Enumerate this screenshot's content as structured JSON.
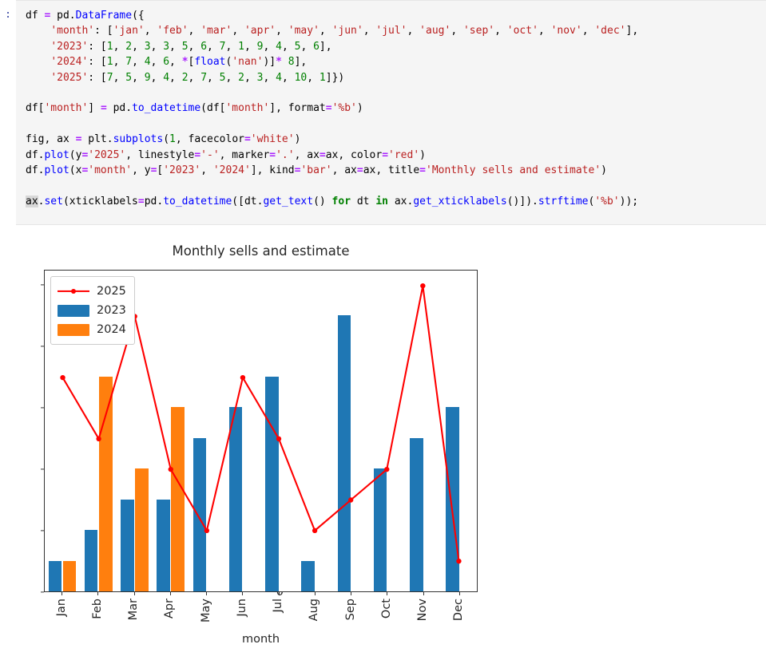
{
  "cell": {
    "prompt": ":",
    "code_lines": [
      [
        {
          "t": "df ",
          "c": "plain"
        },
        {
          "t": "=",
          "c": "op"
        },
        {
          "t": " pd.",
          "c": "plain"
        },
        {
          "t": "DataFrame",
          "c": "fn"
        },
        {
          "t": "({",
          "c": "plain"
        }
      ],
      [
        {
          "t": "    ",
          "c": "plain"
        },
        {
          "t": "'month'",
          "c": "str"
        },
        {
          "t": ": [",
          "c": "plain"
        },
        {
          "t": "'jan'",
          "c": "str"
        },
        {
          "t": ", ",
          "c": "plain"
        },
        {
          "t": "'feb'",
          "c": "str"
        },
        {
          "t": ", ",
          "c": "plain"
        },
        {
          "t": "'mar'",
          "c": "str"
        },
        {
          "t": ", ",
          "c": "plain"
        },
        {
          "t": "'apr'",
          "c": "str"
        },
        {
          "t": ", ",
          "c": "plain"
        },
        {
          "t": "'may'",
          "c": "str"
        },
        {
          "t": ", ",
          "c": "plain"
        },
        {
          "t": "'jun'",
          "c": "str"
        },
        {
          "t": ", ",
          "c": "plain"
        },
        {
          "t": "'jul'",
          "c": "str"
        },
        {
          "t": ", ",
          "c": "plain"
        },
        {
          "t": "'aug'",
          "c": "str"
        },
        {
          "t": ", ",
          "c": "plain"
        },
        {
          "t": "'sep'",
          "c": "str"
        },
        {
          "t": ", ",
          "c": "plain"
        },
        {
          "t": "'oct'",
          "c": "str"
        },
        {
          "t": ", ",
          "c": "plain"
        },
        {
          "t": "'nov'",
          "c": "str"
        },
        {
          "t": ", ",
          "c": "plain"
        },
        {
          "t": "'dec'",
          "c": "str"
        },
        {
          "t": "],",
          "c": "plain"
        }
      ],
      [
        {
          "t": "    ",
          "c": "plain"
        },
        {
          "t": "'2023'",
          "c": "str"
        },
        {
          "t": ": [",
          "c": "plain"
        },
        {
          "t": "1",
          "c": "num"
        },
        {
          "t": ", ",
          "c": "plain"
        },
        {
          "t": "2",
          "c": "num"
        },
        {
          "t": ", ",
          "c": "plain"
        },
        {
          "t": "3",
          "c": "num"
        },
        {
          "t": ", ",
          "c": "plain"
        },
        {
          "t": "3",
          "c": "num"
        },
        {
          "t": ", ",
          "c": "plain"
        },
        {
          "t": "5",
          "c": "num"
        },
        {
          "t": ", ",
          "c": "plain"
        },
        {
          "t": "6",
          "c": "num"
        },
        {
          "t": ", ",
          "c": "plain"
        },
        {
          "t": "7",
          "c": "num"
        },
        {
          "t": ", ",
          "c": "plain"
        },
        {
          "t": "1",
          "c": "num"
        },
        {
          "t": ", ",
          "c": "plain"
        },
        {
          "t": "9",
          "c": "num"
        },
        {
          "t": ", ",
          "c": "plain"
        },
        {
          "t": "4",
          "c": "num"
        },
        {
          "t": ", ",
          "c": "plain"
        },
        {
          "t": "5",
          "c": "num"
        },
        {
          "t": ", ",
          "c": "plain"
        },
        {
          "t": "6",
          "c": "num"
        },
        {
          "t": "],",
          "c": "plain"
        }
      ],
      [
        {
          "t": "    ",
          "c": "plain"
        },
        {
          "t": "'2024'",
          "c": "str"
        },
        {
          "t": ": [",
          "c": "plain"
        },
        {
          "t": "1",
          "c": "num"
        },
        {
          "t": ", ",
          "c": "plain"
        },
        {
          "t": "7",
          "c": "num"
        },
        {
          "t": ", ",
          "c": "plain"
        },
        {
          "t": "4",
          "c": "num"
        },
        {
          "t": ", ",
          "c": "plain"
        },
        {
          "t": "6",
          "c": "num"
        },
        {
          "t": ", ",
          "c": "plain"
        },
        {
          "t": "*",
          "c": "op"
        },
        {
          "t": "[",
          "c": "plain"
        },
        {
          "t": "float",
          "c": "fn"
        },
        {
          "t": "(",
          "c": "plain"
        },
        {
          "t": "'nan'",
          "c": "str"
        },
        {
          "t": ")]",
          "c": "plain"
        },
        {
          "t": "*",
          "c": "op"
        },
        {
          "t": " ",
          "c": "plain"
        },
        {
          "t": "8",
          "c": "num"
        },
        {
          "t": "],",
          "c": "plain"
        }
      ],
      [
        {
          "t": "    ",
          "c": "plain"
        },
        {
          "t": "'2025'",
          "c": "str"
        },
        {
          "t": ": [",
          "c": "plain"
        },
        {
          "t": "7",
          "c": "num"
        },
        {
          "t": ", ",
          "c": "plain"
        },
        {
          "t": "5",
          "c": "num"
        },
        {
          "t": ", ",
          "c": "plain"
        },
        {
          "t": "9",
          "c": "num"
        },
        {
          "t": ", ",
          "c": "plain"
        },
        {
          "t": "4",
          "c": "num"
        },
        {
          "t": ", ",
          "c": "plain"
        },
        {
          "t": "2",
          "c": "num"
        },
        {
          "t": ", ",
          "c": "plain"
        },
        {
          "t": "7",
          "c": "num"
        },
        {
          "t": ", ",
          "c": "plain"
        },
        {
          "t": "5",
          "c": "num"
        },
        {
          "t": ", ",
          "c": "plain"
        },
        {
          "t": "2",
          "c": "num"
        },
        {
          "t": ", ",
          "c": "plain"
        },
        {
          "t": "3",
          "c": "num"
        },
        {
          "t": ", ",
          "c": "plain"
        },
        {
          "t": "4",
          "c": "num"
        },
        {
          "t": ", ",
          "c": "plain"
        },
        {
          "t": "10",
          "c": "num"
        },
        {
          "t": ", ",
          "c": "plain"
        },
        {
          "t": "1",
          "c": "num"
        },
        {
          "t": "]})",
          "c": "plain"
        }
      ],
      [],
      [
        {
          "t": "df[",
          "c": "plain"
        },
        {
          "t": "'month'",
          "c": "str"
        },
        {
          "t": "] ",
          "c": "plain"
        },
        {
          "t": "=",
          "c": "op"
        },
        {
          "t": " pd.",
          "c": "plain"
        },
        {
          "t": "to_datetime",
          "c": "fn"
        },
        {
          "t": "(df[",
          "c": "plain"
        },
        {
          "t": "'month'",
          "c": "str"
        },
        {
          "t": "], format",
          "c": "plain"
        },
        {
          "t": "=",
          "c": "op"
        },
        {
          "t": "'%b'",
          "c": "str"
        },
        {
          "t": ")",
          "c": "plain"
        }
      ],
      [],
      [
        {
          "t": "fig, ax ",
          "c": "plain"
        },
        {
          "t": "=",
          "c": "op"
        },
        {
          "t": " plt.",
          "c": "plain"
        },
        {
          "t": "subplots",
          "c": "fn"
        },
        {
          "t": "(",
          "c": "plain"
        },
        {
          "t": "1",
          "c": "num"
        },
        {
          "t": ", facecolor",
          "c": "plain"
        },
        {
          "t": "=",
          "c": "op"
        },
        {
          "t": "'white'",
          "c": "str"
        },
        {
          "t": ")",
          "c": "plain"
        }
      ],
      [
        {
          "t": "df.",
          "c": "plain"
        },
        {
          "t": "plot",
          "c": "fn"
        },
        {
          "t": "(y",
          "c": "plain"
        },
        {
          "t": "=",
          "c": "op"
        },
        {
          "t": "'2025'",
          "c": "str"
        },
        {
          "t": ", linestyle",
          "c": "plain"
        },
        {
          "t": "=",
          "c": "op"
        },
        {
          "t": "'-'",
          "c": "str"
        },
        {
          "t": ", marker",
          "c": "plain"
        },
        {
          "t": "=",
          "c": "op"
        },
        {
          "t": "'.'",
          "c": "str"
        },
        {
          "t": ", ax",
          "c": "plain"
        },
        {
          "t": "=",
          "c": "op"
        },
        {
          "t": "ax, color",
          "c": "plain"
        },
        {
          "t": "=",
          "c": "op"
        },
        {
          "t": "'red'",
          "c": "str"
        },
        {
          "t": ")",
          "c": "plain"
        }
      ],
      [
        {
          "t": "df.",
          "c": "plain"
        },
        {
          "t": "plot",
          "c": "fn"
        },
        {
          "t": "(x",
          "c": "plain"
        },
        {
          "t": "=",
          "c": "op"
        },
        {
          "t": "'month'",
          "c": "str"
        },
        {
          "t": ", y",
          "c": "plain"
        },
        {
          "t": "=",
          "c": "op"
        },
        {
          "t": "[",
          "c": "plain"
        },
        {
          "t": "'2023'",
          "c": "str"
        },
        {
          "t": ", ",
          "c": "plain"
        },
        {
          "t": "'2024'",
          "c": "str"
        },
        {
          "t": "], kind",
          "c": "plain"
        },
        {
          "t": "=",
          "c": "op"
        },
        {
          "t": "'bar'",
          "c": "str"
        },
        {
          "t": ", ax",
          "c": "plain"
        },
        {
          "t": "=",
          "c": "op"
        },
        {
          "t": "ax, title",
          "c": "plain"
        },
        {
          "t": "=",
          "c": "op"
        },
        {
          "t": "'Monthly sells and estimate'",
          "c": "str"
        },
        {
          "t": ")",
          "c": "plain"
        }
      ],
      [],
      [
        {
          "t": "ax",
          "c": "hl"
        },
        {
          "t": ".",
          "c": "plain"
        },
        {
          "t": "set",
          "c": "fn"
        },
        {
          "t": "(xticklabels",
          "c": "plain"
        },
        {
          "t": "=",
          "c": "op"
        },
        {
          "t": "pd.",
          "c": "plain"
        },
        {
          "t": "to_datetime",
          "c": "fn"
        },
        {
          "t": "([dt.",
          "c": "plain"
        },
        {
          "t": "get_text",
          "c": "fn"
        },
        {
          "t": "() ",
          "c": "plain"
        },
        {
          "t": "for",
          "c": "kw"
        },
        {
          "t": " dt ",
          "c": "plain"
        },
        {
          "t": "in",
          "c": "kw"
        },
        {
          "t": " ax.",
          "c": "plain"
        },
        {
          "t": "get_xticklabels",
          "c": "fn"
        },
        {
          "t": "()]).",
          "c": "plain"
        },
        {
          "t": "strftime",
          "c": "fn"
        },
        {
          "t": "(",
          "c": "plain"
        },
        {
          "t": "'%b'",
          "c": "str"
        },
        {
          "t": "));",
          "c": "plain"
        }
      ]
    ]
  },
  "chart_data": {
    "type": "bar",
    "title": "Monthly sells and estimate",
    "xlabel": "month",
    "ylabel": "",
    "categories": [
      "Jan",
      "Feb",
      "Mar",
      "Apr",
      "May",
      "Jun",
      "Jul",
      "Aug",
      "Sep",
      "Oct",
      "Nov",
      "Dec"
    ],
    "ylim": [
      0,
      10.5
    ],
    "yticks": [
      0,
      2,
      4,
      6,
      8,
      10
    ],
    "grid": false,
    "legend_position": "upper left",
    "series": [
      {
        "name": "2025",
        "kind": "line",
        "color": "#ff0000",
        "marker": ".",
        "linestyle": "-",
        "values": [
          7,
          5,
          9,
          4,
          2,
          7,
          5,
          2,
          3,
          4,
          10,
          1
        ]
      },
      {
        "name": "2023",
        "kind": "bar",
        "color": "#1f77b4",
        "values": [
          1,
          2,
          3,
          3,
          5,
          6,
          7,
          1,
          9,
          4,
          5,
          6
        ]
      },
      {
        "name": "2024",
        "kind": "bar",
        "color": "#ff7f0e",
        "values": [
          1,
          7,
          4,
          6,
          null,
          null,
          null,
          null,
          null,
          null,
          null,
          null
        ]
      }
    ]
  }
}
